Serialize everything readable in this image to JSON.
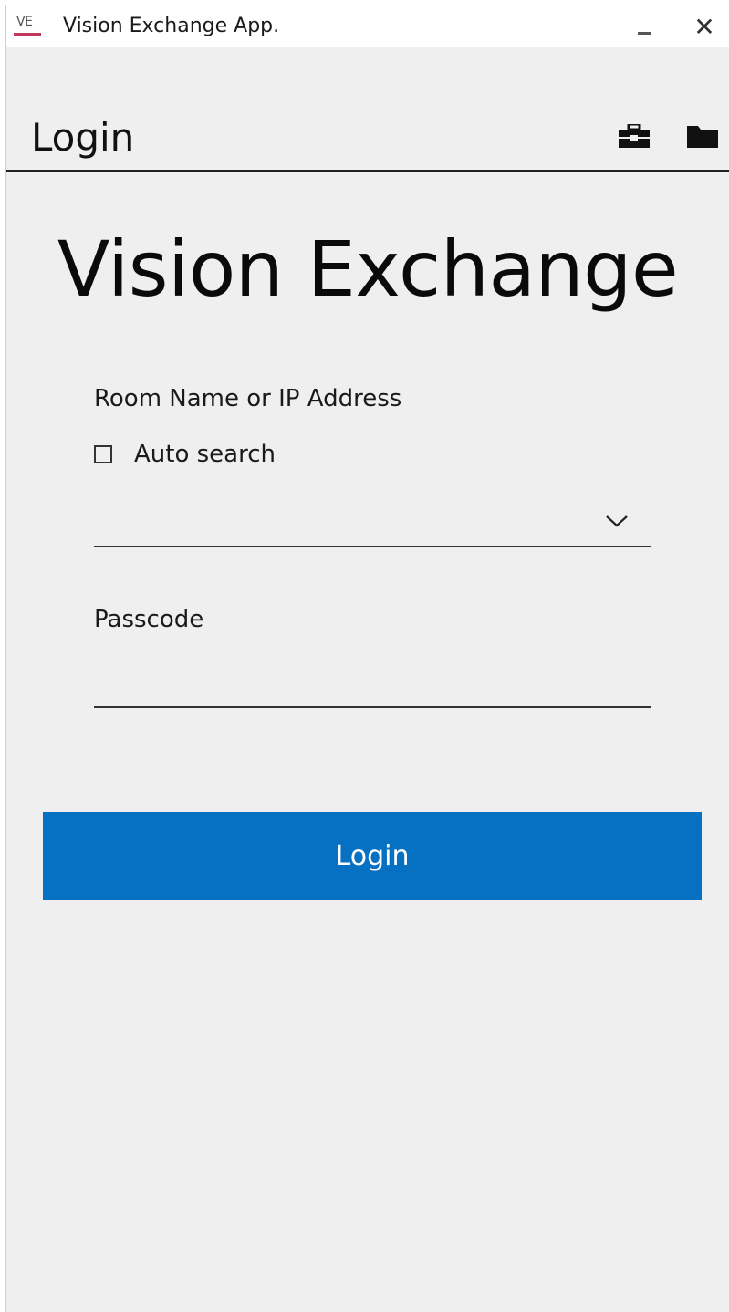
{
  "window": {
    "title": "Vision Exchange App.",
    "app_icon_text": "VE",
    "minimize_icon": "minimize-icon",
    "close_icon": "close-icon",
    "close_glyph": "✕"
  },
  "header": {
    "title": "Login",
    "icons": [
      "toolbox-icon",
      "folder-icon"
    ]
  },
  "brand": {
    "title": "Vision Exchange"
  },
  "form": {
    "room_label": "Room Name or IP Address",
    "auto_search_label": "Auto search",
    "auto_search_checked": false,
    "room_value": "",
    "passcode_label": "Passcode",
    "passcode_value": ""
  },
  "actions": {
    "login_label": "Login"
  },
  "colors": {
    "accent": "#0670c3",
    "background": "#efefef",
    "icon_underline": "#c0395a"
  }
}
